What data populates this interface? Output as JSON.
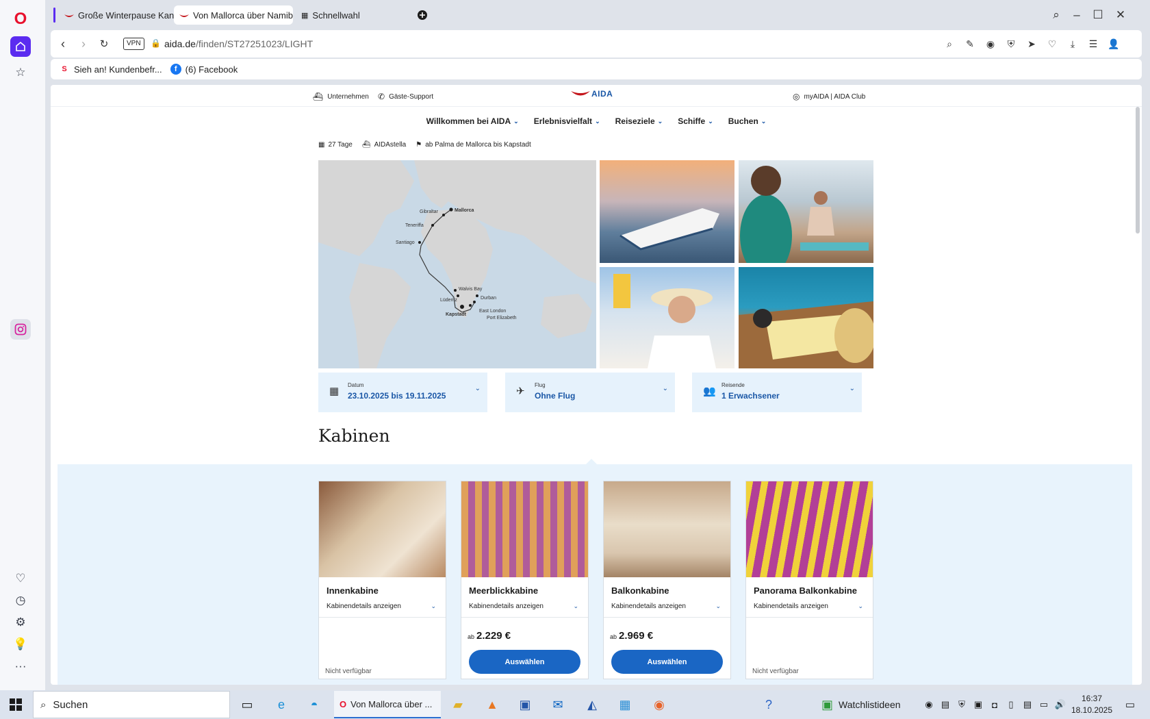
{
  "tabs": [
    {
      "title": "Große Winterpause Kanar"
    },
    {
      "title": "Von Mallorca über Namib"
    },
    {
      "title": "Schnellwahl"
    }
  ],
  "addressbar": {
    "vpn": "VPN",
    "url_host": "aida.de",
    "url_path": "/finden/ST27251023/LIGHT"
  },
  "bookmarks": [
    {
      "label": "Sieh an! Kundenbefr...",
      "icon": "S"
    },
    {
      "label": "(6) Facebook",
      "icon": "f"
    }
  ],
  "site": {
    "topbar": {
      "company": "Unternehmen",
      "support": "Gäste-Support",
      "logo": "AIDA",
      "account": "myAIDA | AIDA Club"
    },
    "nav": [
      "Willkommen bei AIDA",
      "Erlebnisvielfalt",
      "Reiseziele",
      "Schiffe",
      "Buchen"
    ],
    "meta": {
      "days": "27 Tage",
      "ship": "AIDAstella",
      "route": "ab Palma de Mallorca bis Kapstadt"
    },
    "map_labels": {
      "mallorca": "Mallorca",
      "gibraltar": "Gibraltar",
      "teneriffa": "Teneriffa",
      "santiago": "Santiago",
      "walvis": "Walvis Bay",
      "luderitz": "Lüderitz",
      "durban": "Durban",
      "kapstadt": "Kapstadt",
      "eastlondon": "East London",
      "portelizabeth": "Port Elizabeth"
    },
    "selectors": {
      "date": {
        "label": "Datum",
        "value": "23.10.2025 bis 19.11.2025"
      },
      "flight": {
        "label": "Flug",
        "value": "Ohne Flug"
      },
      "travellers": {
        "label": "Reisende",
        "value": "1 Erwachsener"
      }
    },
    "cabins_title": "Kabinen",
    "cabins": [
      {
        "name": "Innenkabine",
        "details": "Kabinendetails anzeigen",
        "status": "Nicht verfügbar"
      },
      {
        "name": "Meerblickkabine",
        "details": "Kabinendetails anzeigen",
        "ab": "ab",
        "price": "2.229 €",
        "button": "Auswählen"
      },
      {
        "name": "Balkonkabine",
        "details": "Kabinendetails anzeigen",
        "ab": "ab",
        "price": "2.969 €",
        "button": "Auswählen"
      },
      {
        "name": "Panorama Balkonkabine",
        "details": "Kabinendetails anzeigen",
        "status": "Nicht verfügbar"
      }
    ]
  },
  "taskbar": {
    "search": "Suchen",
    "active_app": "Von Mallorca über ...",
    "watchlist": "Watchlistideen",
    "time": "16:37",
    "date": "18.10.2025"
  },
  "colors": {
    "accent": "#1a57a6",
    "button": "#1a66c4",
    "opera_red": "#e8112d",
    "opera_purple": "#5b2cf0",
    "cabin_bg": "#e8f3fc"
  }
}
